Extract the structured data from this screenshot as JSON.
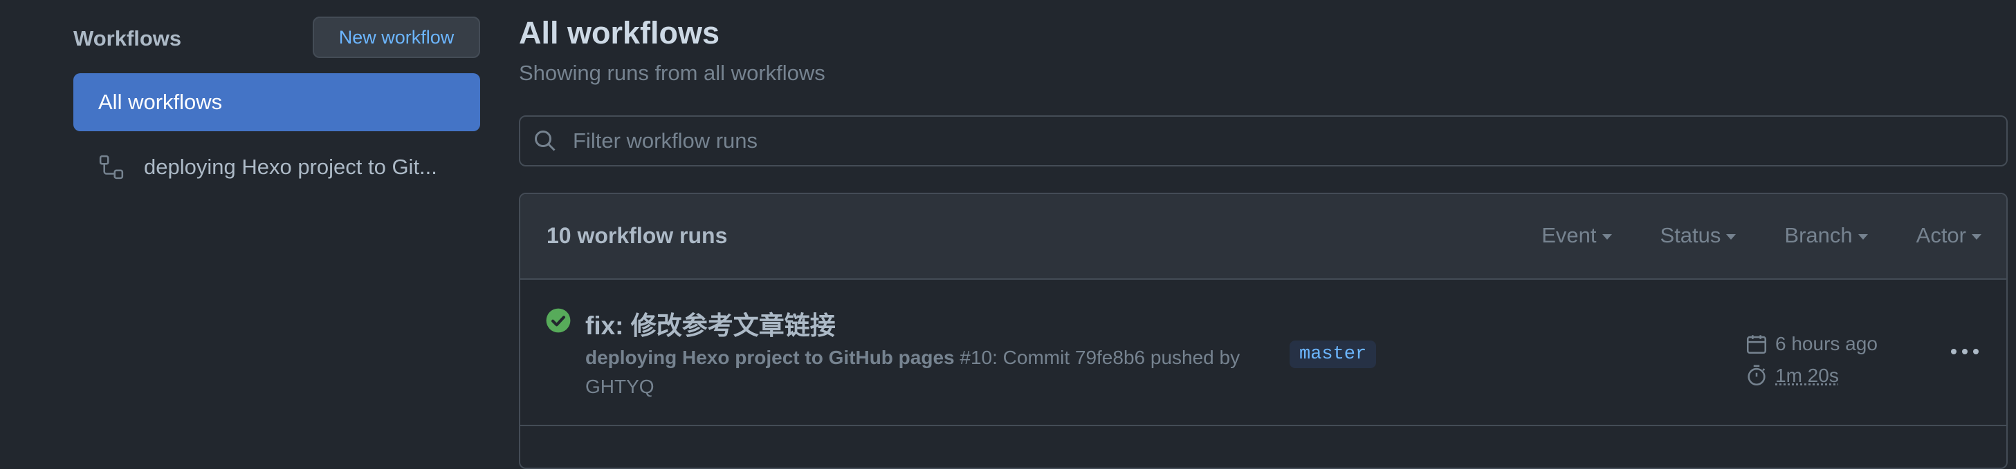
{
  "sidebar": {
    "title": "Workflows",
    "new_button": "New workflow",
    "items": [
      {
        "label": "All workflows",
        "active": true
      },
      {
        "label": "deploying Hexo project to Git...",
        "icon": "workflow-icon"
      }
    ]
  },
  "main": {
    "title": "All workflows",
    "subtitle": "Showing runs from all workflows",
    "filter_placeholder": "Filter workflow runs",
    "runs_count": "10 workflow runs",
    "filters": [
      "Event",
      "Status",
      "Branch",
      "Actor"
    ],
    "runs": [
      {
        "title": "fix: 修改参考文章链接",
        "workflow_name": "deploying Hexo project to GitHub pages",
        "meta_rest": " #10: Commit 79fe8b6 pushed by GHTYQ",
        "branch": "master",
        "time_ago": "6 hours ago",
        "duration": "1m 20s",
        "status": "success"
      }
    ]
  },
  "colors": {
    "background": "#22272e",
    "accent": "#4474c6",
    "link": "#6cb6ff",
    "success": "#57ab5a",
    "border": "#444c56"
  }
}
